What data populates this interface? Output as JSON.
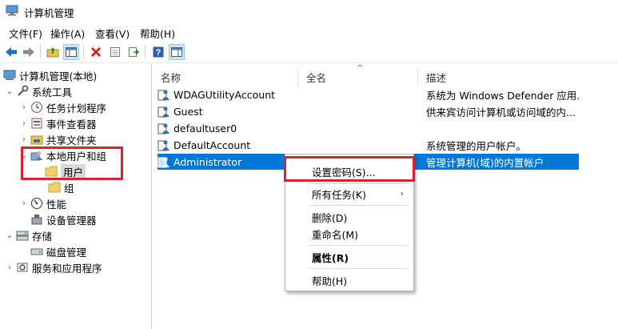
{
  "window": {
    "title": "计算机管理"
  },
  "menu": [
    "文件(F)",
    "操作(A)",
    "查看(V)",
    "帮助(H)"
  ],
  "tree": {
    "root": "计算机管理(本地)",
    "items": [
      {
        "label": "系统工具"
      },
      {
        "label": "任务计划程序"
      },
      {
        "label": "事件查看器"
      },
      {
        "label": "共享文件夹"
      },
      {
        "label": "本地用户和组"
      },
      {
        "label": "用户"
      },
      {
        "label": "组"
      },
      {
        "label": "性能"
      },
      {
        "label": "设备管理器"
      },
      {
        "label": "存储"
      },
      {
        "label": "磁盘管理"
      },
      {
        "label": "服务和应用程序"
      }
    ]
  },
  "list": {
    "columns": [
      "名称",
      "全名",
      "描述"
    ],
    "rows": [
      {
        "name": "WDAGUtilityAccount",
        "description": "系统为 Windows Defender 应用..."
      },
      {
        "name": "Guest",
        "description": "供来宾访问计算机或访问域的内..."
      },
      {
        "name": "defaultuser0",
        "description": ""
      },
      {
        "name": "DefaultAccount",
        "description": "系统管理的用户帐户。"
      },
      {
        "name": "Administrator",
        "description": "管理计算机(域)的内置帐户"
      }
    ]
  },
  "context_menu": {
    "items": [
      "设置密码(S)...",
      "所有任务(K)",
      "删除(D)",
      "重命名(M)",
      "属性(R)",
      "帮助(H)"
    ]
  },
  "colors": {
    "selection": "#0078d7",
    "highlight_box": "#d9232d"
  },
  "icons": [
    "back-icon",
    "forward-icon",
    "up-folder-icon",
    "show-tree-icon",
    "delete-icon",
    "properties-icon",
    "export-icon",
    "help-icon",
    "action-pane-icon"
  ]
}
